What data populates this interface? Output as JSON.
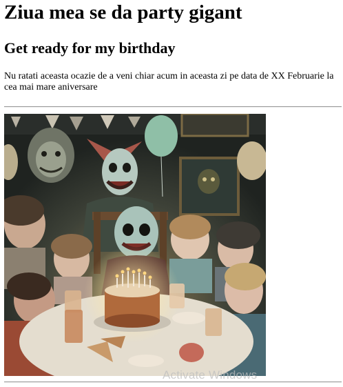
{
  "page": {
    "title": "Ziua mea se da party gigant",
    "subtitle": "Get ready for my birthday",
    "intro": "Nu ratati aceasta ocazie de a veni chiar acum in aceasta zi pe data de XX Februarie la cea mai mare aniversare"
  },
  "image": {
    "subject": "party-photo"
  },
  "overlay": {
    "watermark": "Activate Windows"
  },
  "colors": {
    "text": "#000000",
    "rule": "#9a9a9a",
    "watermark": "#bebebe"
  }
}
